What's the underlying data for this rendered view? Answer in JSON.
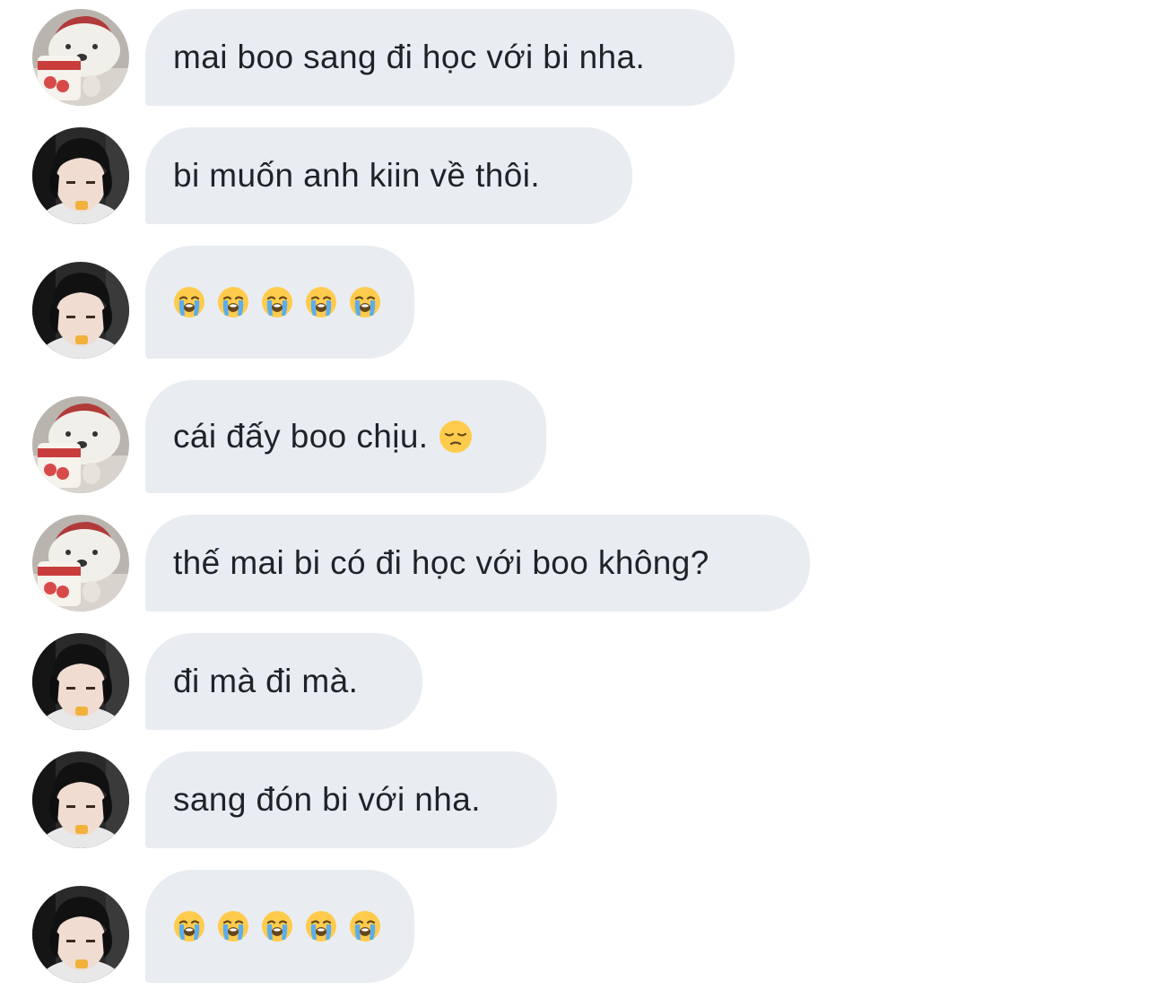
{
  "messages": [
    {
      "avatar": "bear-avatar",
      "text": "mai boo sang đi học với bi nha."
    },
    {
      "avatar": "boy-avatar",
      "text": "bi muốn anh kiin về thôi."
    },
    {
      "avatar": "boy-avatar",
      "emojis": [
        "loudly-crying-face-icon",
        "loudly-crying-face-icon",
        "loudly-crying-face-icon",
        "loudly-crying-face-icon",
        "loudly-crying-face-icon"
      ]
    },
    {
      "avatar": "bear-avatar",
      "text": "cái đấy boo chịu.",
      "trailing_emoji": "pensive-face-icon"
    },
    {
      "avatar": "bear-avatar",
      "text": "thế mai bi có đi học với boo không?"
    },
    {
      "avatar": "boy-avatar",
      "text": "đi mà đi mà."
    },
    {
      "avatar": "boy-avatar",
      "text": "sang đón bi với nha."
    },
    {
      "avatar": "boy-avatar",
      "emojis": [
        "loudly-crying-face-icon",
        "loudly-crying-face-icon",
        "loudly-crying-face-icon",
        "loudly-crying-face-icon",
        "loudly-crying-face-icon"
      ]
    }
  ],
  "colors": {
    "bubble_bg": "#e9edf1",
    "text": "#1f2329",
    "page_bg": "#ffffff"
  }
}
